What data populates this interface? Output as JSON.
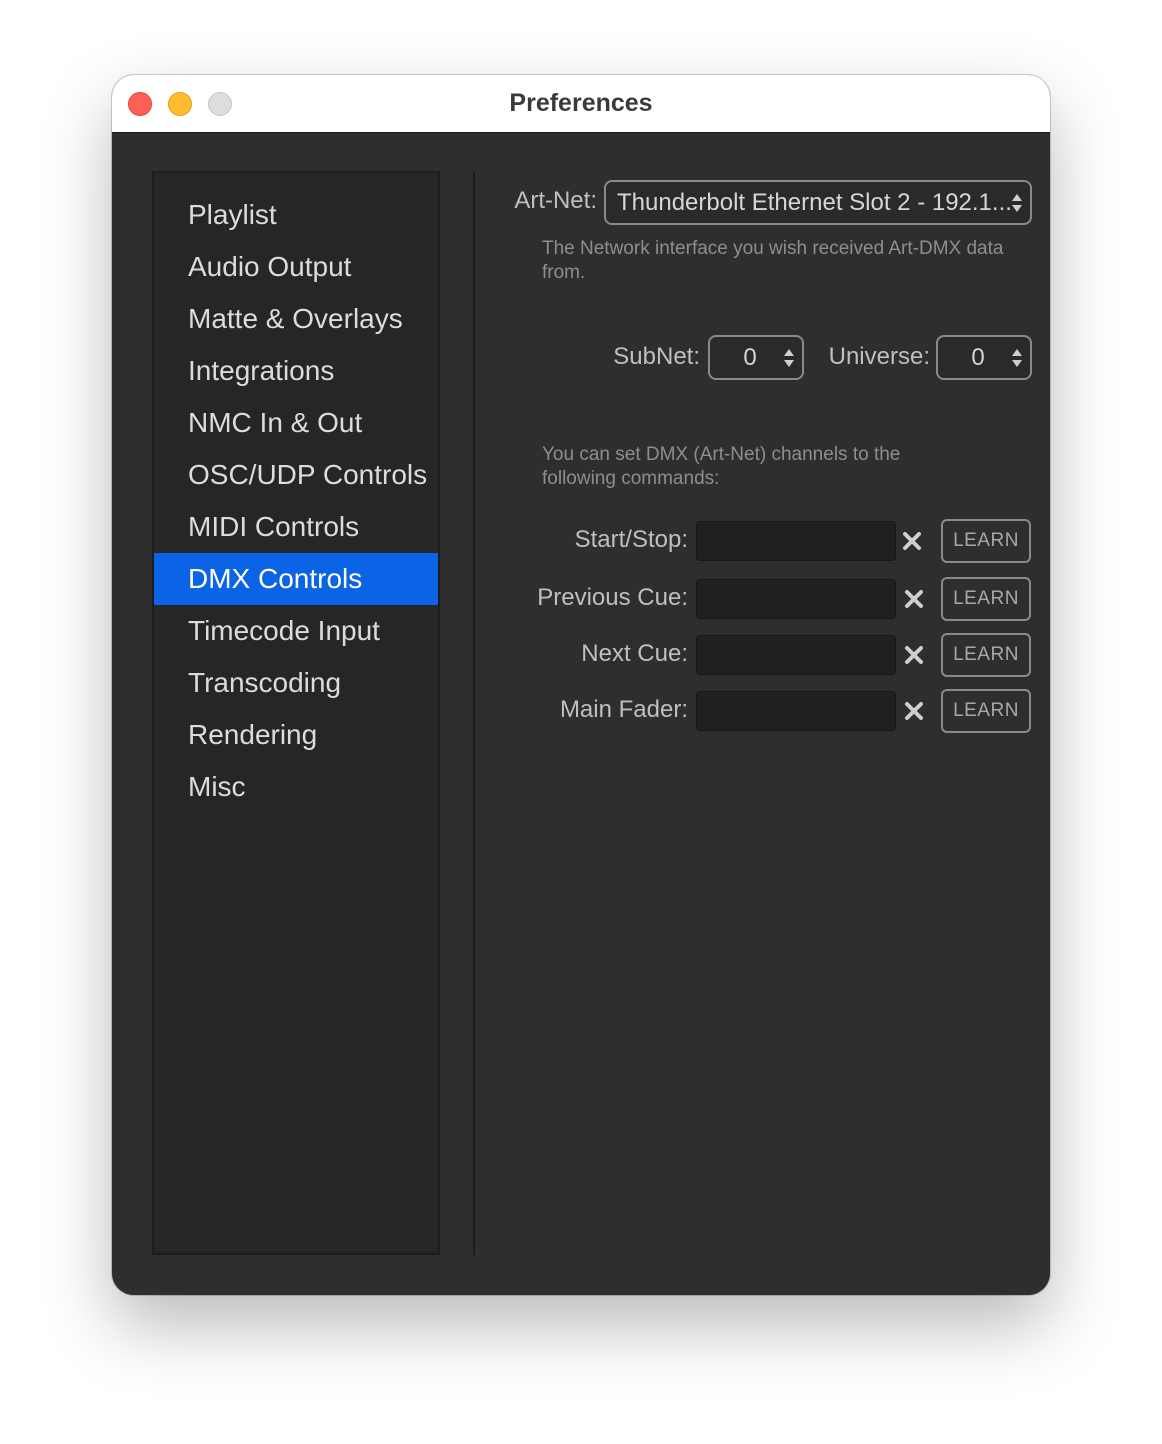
{
  "window": {
    "title": "Preferences"
  },
  "sidebar": {
    "selected": "DMX Controls",
    "items": [
      {
        "label": "Playlist"
      },
      {
        "label": "Audio Output"
      },
      {
        "label": "Matte & Overlays"
      },
      {
        "label": "Integrations"
      },
      {
        "label": "NMC In & Out"
      },
      {
        "label": "OSC/UDP Controls"
      },
      {
        "label": "MIDI Controls"
      },
      {
        "label": "DMX Controls"
      },
      {
        "label": "Timecode Input"
      },
      {
        "label": "Transcoding"
      },
      {
        "label": "Rendering"
      },
      {
        "label": "Misc"
      }
    ]
  },
  "artnet": {
    "label": "Art-Net:",
    "value": "Thunderbolt Ethernet Slot 2 - 192.1...",
    "help": "The Network interface you wish received Art-DMX data from."
  },
  "subnet": {
    "label": "SubNet:",
    "value": "0"
  },
  "universe": {
    "label": "Universe:",
    "value": "0"
  },
  "commands_help": "You can set DMX (Art-Net) channels to the following commands:",
  "commands": [
    {
      "label": "Start/Stop:",
      "value": "",
      "learn": "LEARN"
    },
    {
      "label": "Previous Cue:",
      "value": "",
      "learn": "LEARN"
    },
    {
      "label": "Next Cue:",
      "value": "",
      "learn": "LEARN"
    },
    {
      "label": "Main Fader:",
      "value": "",
      "learn": "LEARN"
    }
  ],
  "icons": {
    "clear": "clear-x-icon",
    "stepper": "stepper-arrows-icon"
  },
  "colors": {
    "selection": "#0b63e6",
    "window_bg": "#2e2e2e",
    "sidebar_bg": "#262626"
  }
}
